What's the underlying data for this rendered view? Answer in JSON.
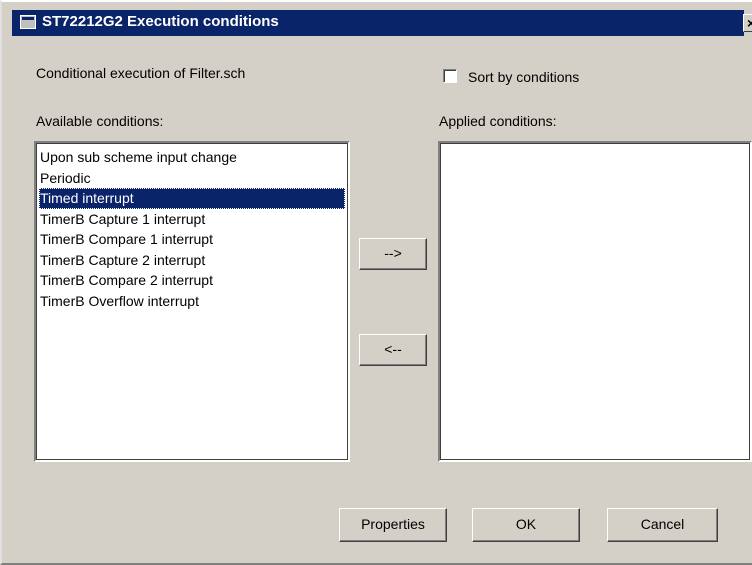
{
  "window": {
    "title": "ST72212G2 Execution conditions",
    "close_glyph": "×"
  },
  "subtitle": "Conditional execution of Filter.sch",
  "sort_checkbox": {
    "label": "Sort by conditions",
    "checked": false
  },
  "available": {
    "label": "Available conditions:",
    "items": [
      "Upon sub scheme input change",
      "Periodic",
      "Timed interrupt",
      "TimerB Capture 1 interrupt",
      "TimerB Compare 1 interrupt",
      "TimerB Capture 2 interrupt",
      "TimerB Compare 2 interrupt",
      "TimerB Overflow interrupt"
    ],
    "selected_index": 2
  },
  "applied": {
    "label": "Applied conditions:",
    "items": []
  },
  "buttons": {
    "add": "-->",
    "remove": "<--",
    "properties": "Properties",
    "ok": "OK",
    "cancel": "Cancel"
  },
  "colors": {
    "titlebar": "#0a246a",
    "dialog_bg": "#d4d0c8",
    "selection": "#0a246a"
  }
}
